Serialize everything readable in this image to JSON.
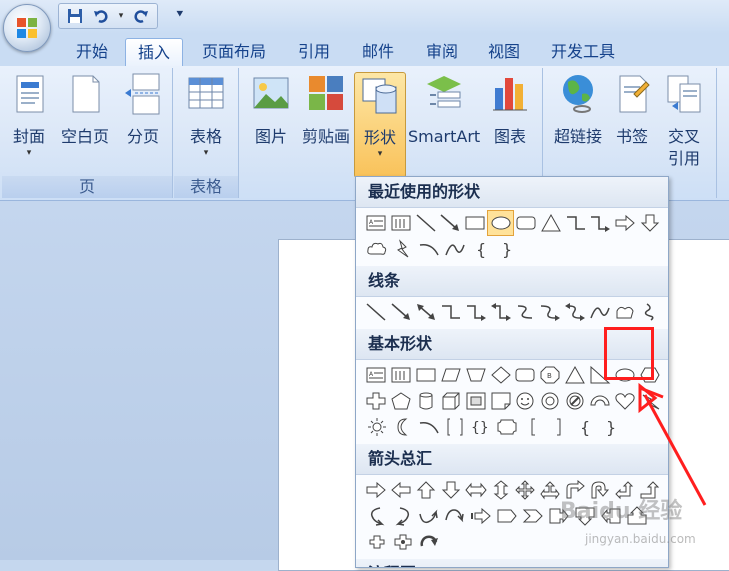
{
  "tabs": [
    "开始",
    "插入",
    "页面布局",
    "引用",
    "邮件",
    "审阅",
    "视图",
    "开发工具"
  ],
  "active_tab": "插入",
  "ribbon": {
    "groups": {
      "pages": {
        "label": "页",
        "buttons": [
          "封面",
          "空白页",
          "分页"
        ]
      },
      "tables": {
        "label": "表格",
        "buttons": [
          "表格"
        ]
      },
      "illustrations": {
        "buttons": [
          "图片",
          "剪贴画",
          "形状",
          "SmartArt",
          "图表"
        ]
      },
      "links": {
        "buttons": [
          "超链接",
          "书签",
          "交叉",
          "引用"
        ]
      }
    }
  },
  "shapes_menu": {
    "sections": {
      "recent": "最近使用的形状",
      "lines": "线条",
      "basic": "基本形状",
      "arrows": "箭头总汇",
      "flowchart": "流程图"
    }
  },
  "watermark": {
    "text": "Baidu 经验",
    "url": "jingyan.baidu.com"
  },
  "colors": {
    "accent": "#15428b",
    "highlight": "#ff1e1e",
    "pressed": "#f9c25a"
  }
}
